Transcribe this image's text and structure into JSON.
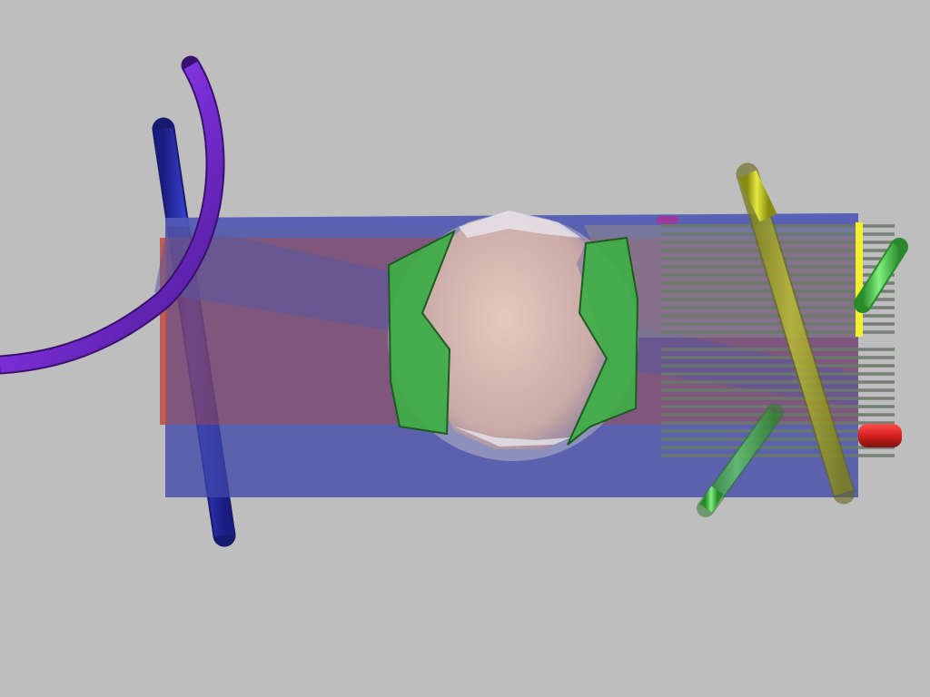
{
  "scene": {
    "background": "#bebebe",
    "objects": [
      {
        "name": "blue-box",
        "color": "#3f47a8",
        "opacity": 0.78
      },
      {
        "name": "red-panel",
        "color": "#b0473f",
        "opacity": 0.55
      },
      {
        "name": "purple-tube",
        "color": "#7a2fd6"
      },
      {
        "name": "blue-rod",
        "color": "#2a2ec0"
      },
      {
        "name": "lens-sphere",
        "color": "#d9b9b3"
      },
      {
        "name": "green-fin",
        "color": "#3fae45"
      },
      {
        "name": "yellow-rod",
        "color": "#d8dc20"
      },
      {
        "name": "green-rod",
        "color": "#5fe060"
      },
      {
        "name": "red-stub",
        "color": "#d62020"
      },
      {
        "name": "comb-plate",
        "color": "#6a7a6a"
      },
      {
        "name": "yellow-strip",
        "color": "#f2ee30"
      },
      {
        "name": "magenta-cap",
        "color": "#9a3a9a"
      }
    ]
  }
}
